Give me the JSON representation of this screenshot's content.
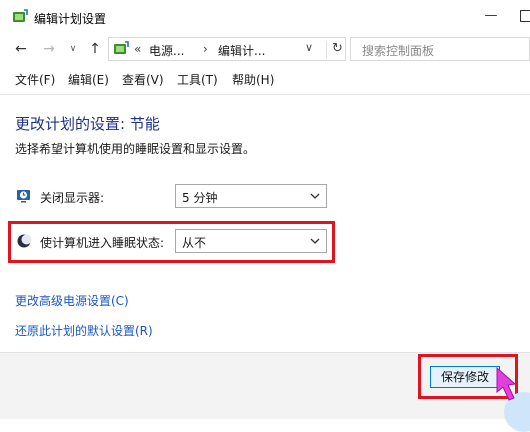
{
  "window": {
    "title": "编辑计划设置"
  },
  "nav": {
    "address_segments": [
      "电源...",
      "编辑计..."
    ],
    "address_prefix": "«",
    "search_placeholder": "搜索控制面板"
  },
  "menu": [
    "文件(F)",
    "编辑(E)",
    "查看(V)",
    "工具(T)",
    "帮助(H)"
  ],
  "content": {
    "title": "更改计划的设置: 节能",
    "subtitle": "选择希望计算机使用的睡眠设置和显示设置。",
    "display_off": {
      "label": "关闭显示器:",
      "value": "5 分钟",
      "icon": "monitor-clock-icon"
    },
    "sleep": {
      "label": "使计算机进入睡眠状态:",
      "value": "从不",
      "icon": "moon-icon"
    },
    "links": [
      "更改高级电源设置(C)",
      "还原此计划的默认设置(R)"
    ]
  },
  "footer": {
    "save_label": "保存修改"
  },
  "colors": {
    "highlight": "#e0141e",
    "title": "#1e3287",
    "link": "#1a56c8",
    "cursor": "#e43ee0"
  }
}
